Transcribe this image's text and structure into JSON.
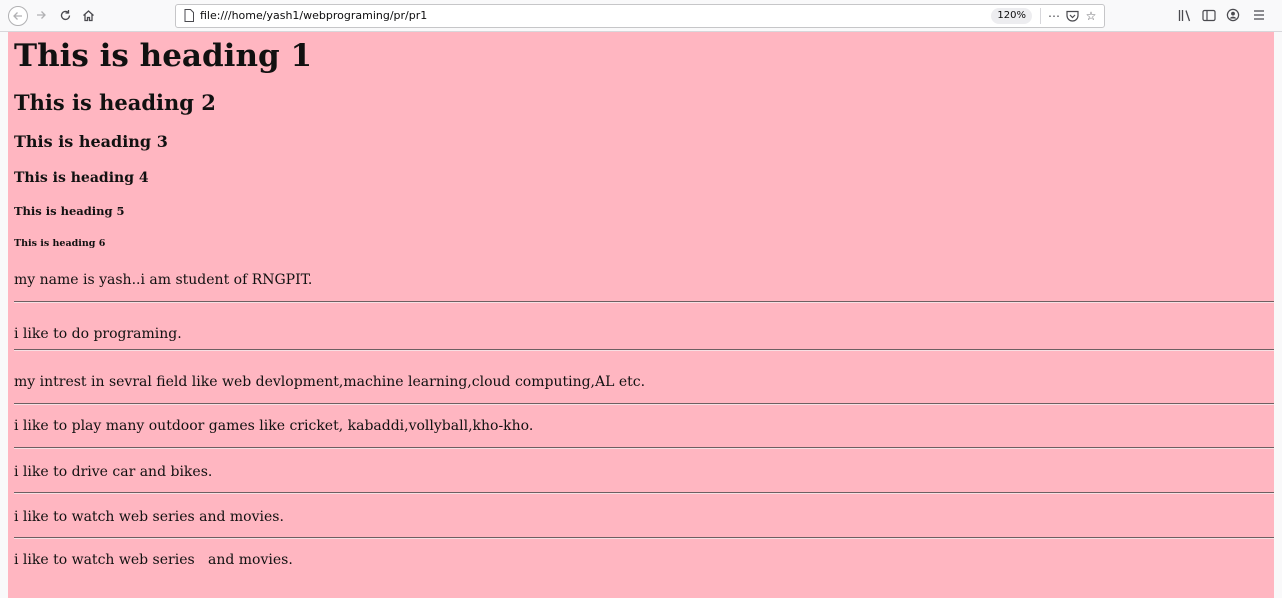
{
  "browser": {
    "url": "file:///home/yash1/webprograming/pr/pr1",
    "zoom": "120%",
    "icons": [
      "back-icon",
      "forward-icon",
      "reload-icon",
      "home-icon",
      "page-icon",
      "more-icon",
      "pocket-icon",
      "star-icon",
      "library-icon",
      "sidebar-icon",
      "account-icon",
      "menu-icon"
    ]
  },
  "page": {
    "background": "#ffb6c1",
    "headings": [
      "This is heading 1",
      "This is heading 2",
      "This is heading 3",
      "This is heading 4",
      "This is heading 5",
      "This is heading 6"
    ],
    "paragraphs": [
      "my name is yash..i am student of RNGPIT.",
      "i like to do programing.",
      "my intrest in sevral field like web devlopment,machine learning,cloud computing,AL etc.",
      "i like to play many outdoor games like cricket, kabaddi,vollyball,kho-kho.",
      "i like to drive car and bikes.",
      "i like to watch web series and movies.",
      "i like to watch web series   and movies."
    ]
  }
}
